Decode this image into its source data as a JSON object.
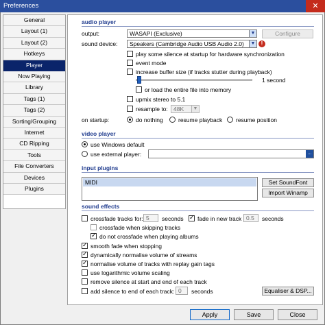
{
  "window": {
    "title": "Preferences",
    "close_glyph": "✕"
  },
  "sidebar": {
    "items": [
      {
        "label": "General"
      },
      {
        "label": "Layout (1)"
      },
      {
        "label": "Layout (2)"
      },
      {
        "label": "Hotkeys"
      },
      {
        "label": "Player"
      },
      {
        "label": "Now Playing"
      },
      {
        "label": "Library"
      },
      {
        "label": "Tags (1)"
      },
      {
        "label": "Tags (2)"
      },
      {
        "label": "Sorting/Grouping"
      },
      {
        "label": "Internet"
      },
      {
        "label": "CD Ripping"
      },
      {
        "label": "Tools"
      },
      {
        "label": "File Converters"
      },
      {
        "label": "Devices"
      },
      {
        "label": "Plugins"
      }
    ],
    "active": "Player"
  },
  "audio_player": {
    "title": "audio player",
    "output_label": "output:",
    "output_value": "WASAPI (Exclusive)",
    "configure_label": "Configure",
    "device_label": "sound device:",
    "device_value": "Speakers (Cambridge Audio USB Audio 2.0)",
    "warn_glyph": "!",
    "play_silence": "play some silence at startup for hardware synchronization",
    "event_mode": "event mode",
    "increase_buffer": "increase buffer size (if tracks stutter during playback)",
    "buffer_value": "1 second",
    "load_entire": "or load the entire file into memory",
    "upmix": "upmix stereo to 5.1",
    "resample": "resample to:",
    "resample_value": "48K",
    "startup_label": "on startup:",
    "startup_options": [
      "do nothing",
      "resume playback",
      "resume position"
    ],
    "startup_selected": "do nothing"
  },
  "video_player": {
    "title": "video player",
    "use_windows": "use Windows default",
    "use_external": "use external player:",
    "external_path": "",
    "browse_glyph": "..."
  },
  "input_plugins": {
    "title": "input plugins",
    "items": [
      "MIDI"
    ],
    "set_soundfont": "Set SoundFont",
    "import_winamp": "Import Winamp"
  },
  "sound_effects": {
    "title": "sound effects",
    "crossfade_for": "crossfade tracks for:",
    "crossfade_value": "5",
    "crossfade_unit": "seconds",
    "fade_in": "fade in new track",
    "fade_in_value": "0.5",
    "fade_in_unit": "seconds",
    "crossfade_skipping": "crossfade when skipping tracks",
    "no_crossfade_albums": "do not crossfade when playing albums",
    "smooth_fade": "smooth fade when stopping",
    "dynamic_normalise": "dynamically normalise volume of streams",
    "replay_gain": "normalise volume of tracks with replay gain tags",
    "log_volume": "use logarithmic volume scaling",
    "remove_silence": "remove silence at start and end of each track",
    "add_silence": "add silence to end of each track:",
    "add_silence_value": "0",
    "add_silence_unit": "seconds",
    "equaliser": "Equaliser & DSP..."
  },
  "footer": {
    "apply": "Apply",
    "save": "Save",
    "close": "Close"
  },
  "colors": {
    "accent": "#1f3b8e",
    "selection": "#0a246a",
    "titlebar": "#2b4f9e"
  }
}
